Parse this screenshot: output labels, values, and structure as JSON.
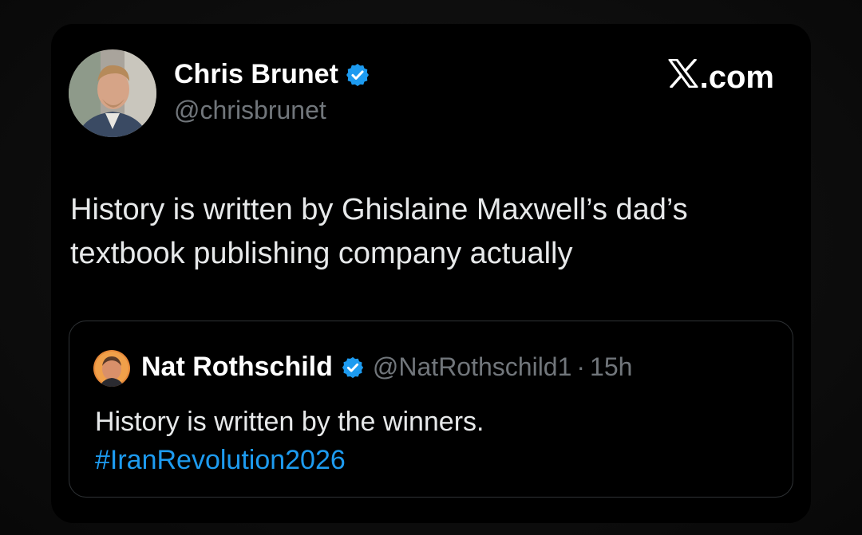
{
  "tweet": {
    "author_name": "Chris Brunet",
    "author_handle": "@chrisbrunet",
    "brand": ".com",
    "text_line1": "History is written by Ghislaine Maxwell’s dad’s",
    "text_line2": "textbook publishing company actually"
  },
  "quoted": {
    "author_name": "Nat Rothschild",
    "author_handle": "@NatRothschild1",
    "separator": "·",
    "time": "15h",
    "text": "History is written by the winners.",
    "hashtag": "#IranRevolution2026"
  },
  "colors": {
    "verified": "#1d9bf0",
    "hashtag": "#1d9bf0",
    "card_bg": "#000000",
    "muted_text": "#71767b"
  },
  "icons": {
    "verified": "verified-badge-icon",
    "x_logo": "x-logo-icon"
  }
}
